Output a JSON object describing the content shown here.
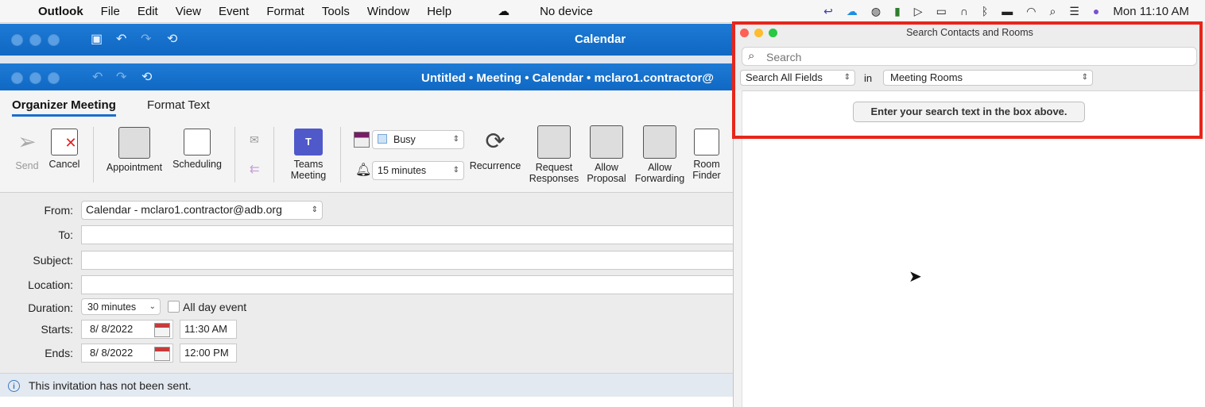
{
  "menubar": {
    "app": "Outlook",
    "items": [
      "File",
      "Edit",
      "View",
      "Event",
      "Format",
      "Tools",
      "Window",
      "Help"
    ],
    "device": "No device",
    "clock": "Mon  11:10 AM"
  },
  "calendar_window": {
    "title": "Calendar"
  },
  "meeting_window": {
    "title": "Untitled • Meeting • Calendar • mclaro1.contractor@"
  },
  "tabs": {
    "organizer": "Organizer Meeting",
    "format_text": "Format Text"
  },
  "ribbon": {
    "send": "Send",
    "cancel": "Cancel",
    "appointment": "Appointment",
    "scheduling": "Scheduling",
    "teams": "Teams\nMeeting",
    "busy": "Busy",
    "reminder": "15 minutes",
    "recurrence": "Recurrence",
    "request_responses": "Request\nResponses",
    "allow_proposal": "Allow\nProposal",
    "allow_forwarding": "Allow\nForwarding",
    "room_finder": "Room\nFinder"
  },
  "form": {
    "from_label": "From:",
    "from_value": "Calendar - mclaro1.contractor@adb.org",
    "to_label": "To:",
    "subject_label": "Subject:",
    "location_label": "Location:",
    "duration_label": "Duration:",
    "duration_value": "30 minutes",
    "all_day": "All day event",
    "starts_label": "Starts:",
    "start_date": "8/  8/2022",
    "start_time": "11:30 AM",
    "ends_label": "Ends:",
    "end_date": "8/  8/2022",
    "end_time": "12:00 PM"
  },
  "infobar": {
    "message": "This invitation has not been sent."
  },
  "dialog": {
    "title": "Search Contacts and Rooms",
    "search_placeholder": "Search",
    "field_scope": "Search All Fields",
    "in_label": "in",
    "source": "Meeting Rooms",
    "hint": "Enter your search text in the box above."
  }
}
